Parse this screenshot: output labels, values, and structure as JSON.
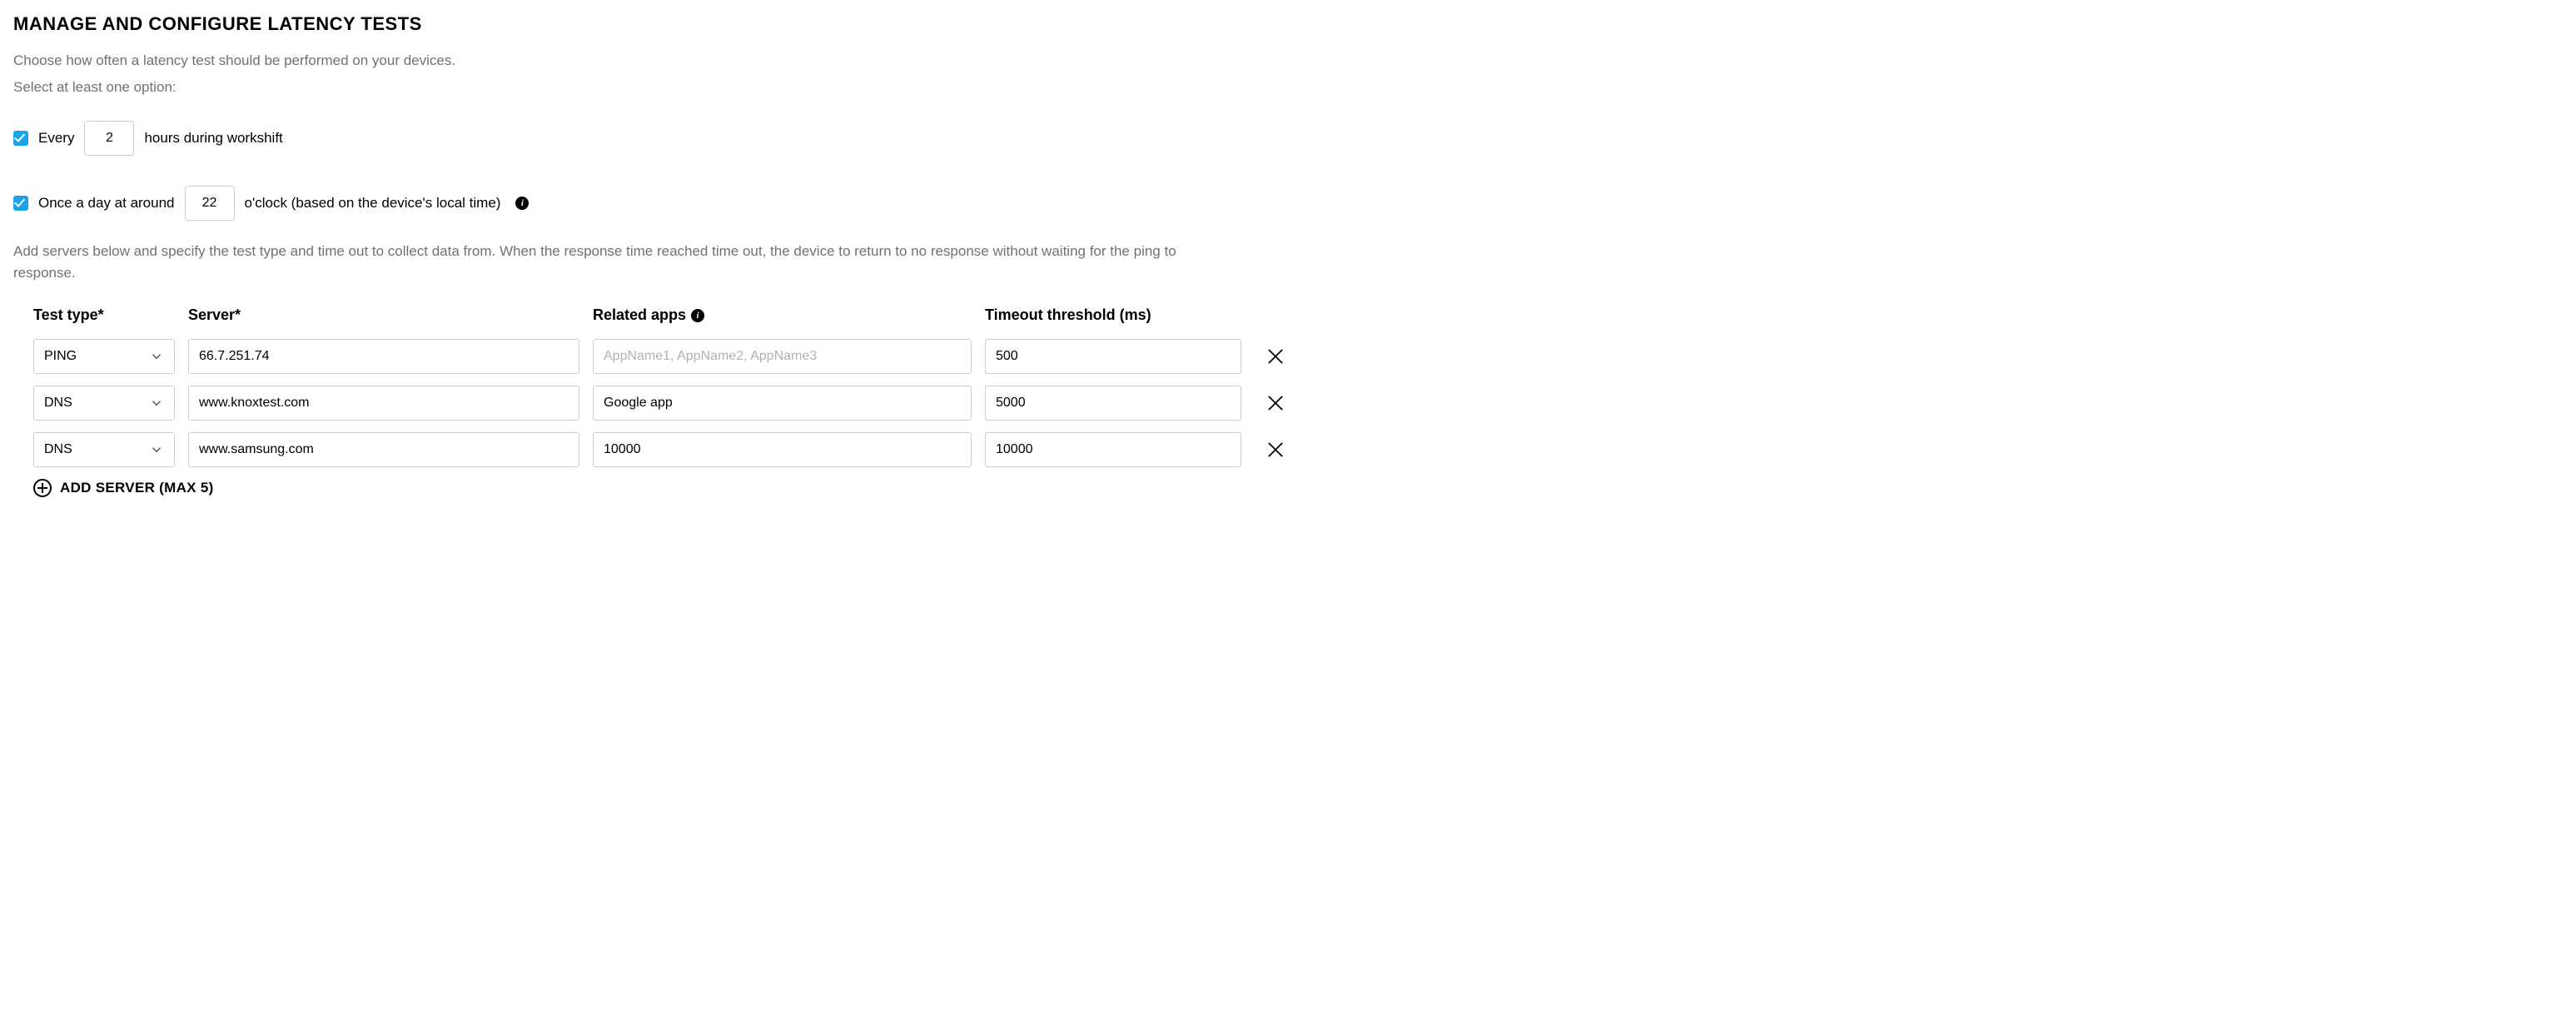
{
  "heading": "MANAGE AND CONFIGURE LATENCY TESTS",
  "description": {
    "line1": "Choose how often a latency test should be performed on your devices.",
    "line2": "Select at least one option:"
  },
  "options": {
    "every": {
      "prefix": "Every",
      "value": "2",
      "suffix": "hours during workshift",
      "checked": true
    },
    "daily": {
      "prefix": "Once a day at around",
      "value": "22",
      "suffix": "o'clock (based on the device's local time)",
      "checked": true
    }
  },
  "servers_description": "Add servers below and specify the test type and time out to collect data from. When the response time reached time out, the device to return to no response without waiting for the ping to response.",
  "table": {
    "headers": {
      "test_type": "Test type*",
      "server": "Server*",
      "related_apps": "Related apps",
      "timeout": "Timeout threshold (ms)"
    },
    "related_apps_placeholder": "AppName1, AppName2, AppName3",
    "rows": [
      {
        "test_type": "PING",
        "server": "66.7.251.74",
        "related_apps": "",
        "timeout": "500"
      },
      {
        "test_type": "DNS",
        "server": "www.knoxtest.com",
        "related_apps": "Google app",
        "timeout": "5000"
      },
      {
        "test_type": "DNS",
        "server": "www.samsung.com",
        "related_apps": "10000",
        "timeout": "10000"
      }
    ]
  },
  "add_server_label": "ADD SERVER (MAX 5)"
}
